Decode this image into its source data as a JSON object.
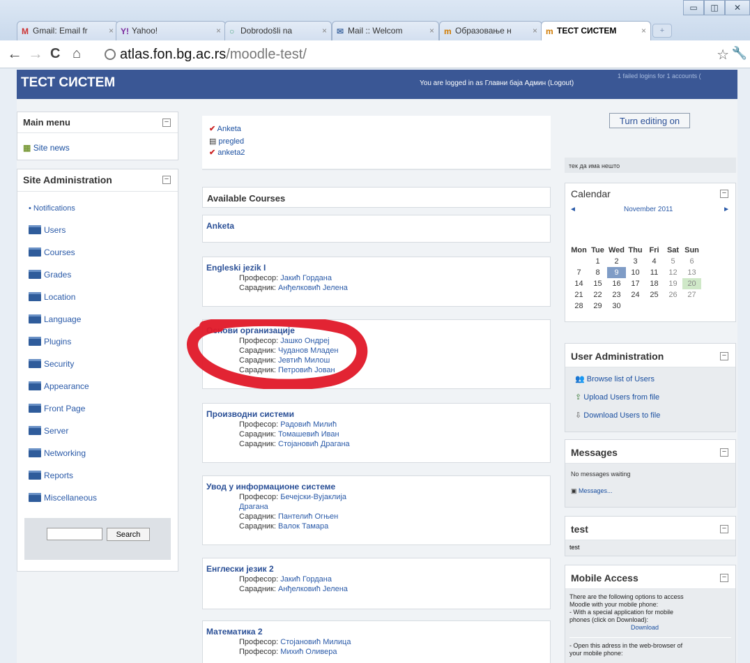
{
  "browser": {
    "tabs": [
      {
        "icon": "M",
        "label": "Gmail: Email fr"
      },
      {
        "icon": "Y!",
        "label": "Yahoo!"
      },
      {
        "icon": "○",
        "label": "Dobrodošli na"
      },
      {
        "icon": "✉",
        "label": "Mail :: Welcom"
      },
      {
        "icon": "m",
        "label": "Образовање н"
      },
      {
        "icon": "m",
        "label": "ТЕСТ СИСТЕМ"
      }
    ],
    "url_host": "atlas.fon.bg.ac.rs",
    "url_path": "/moodle-test/"
  },
  "header": {
    "site_title": "ТЕСТ СИСТЕМ",
    "login_text": "You are logged in as Главни баја Админ (Logout)",
    "failed_logins": "1 failed logins for 1 accounts ("
  },
  "main_menu": {
    "title": "Main menu",
    "items": [
      "Site news"
    ]
  },
  "site_admin": {
    "title": "Site Administration",
    "notifications": "Notifications",
    "items": [
      "Users",
      "Courses",
      "Grades",
      "Location",
      "Language",
      "Plugins",
      "Security",
      "Appearance",
      "Front Page",
      "Server",
      "Networking",
      "Reports",
      "Miscellaneous"
    ]
  },
  "search": {
    "button": "Search",
    "value": ""
  },
  "activities": [
    "Anketa",
    "pregled",
    "anketa2"
  ],
  "available_courses": {
    "title": "Available Courses",
    "courses": [
      {
        "name": "Anketa",
        "lines": []
      },
      {
        "name": "Engleski jezik I",
        "lines": [
          [
            "Професор:",
            "Јакић Гордана"
          ],
          [
            "Сарадник:",
            "Анђелковић Јелена"
          ]
        ]
      },
      {
        "name": "Основи организације",
        "lines": [
          [
            "Професор:",
            "Јашко Ондреј"
          ],
          [
            "Сарадник:",
            "Чуданов Младен"
          ],
          [
            "Сарадник:",
            "Јевтић Милош"
          ],
          [
            "Сарадник:",
            "Петровић Јован"
          ]
        ]
      },
      {
        "name": "Производни системи",
        "lines": [
          [
            "Професор:",
            "Радовић Милић"
          ],
          [
            "Сарадник:",
            "Томашевић Иван"
          ],
          [
            "Сарадник:",
            "Стојановић Драгана"
          ]
        ]
      },
      {
        "name": "Увод у информационе системе",
        "lines": [
          [
            "Професор:",
            "Бечејски-Вујаклија"
          ],
          [
            "",
            "Драгана"
          ],
          [
            "Сарадник:",
            "Пантелић Огњен"
          ],
          [
            "Сарадник:",
            "Валок Тамара"
          ]
        ]
      },
      {
        "name": "Енглески језик 2",
        "lines": [
          [
            "Професор:",
            "Јакић Гордана"
          ],
          [
            "Сарадник:",
            "Анђелковић Јелена"
          ]
        ]
      },
      {
        "name": "Математика 2",
        "lines": [
          [
            "Професор:",
            "Стојановић Милица"
          ],
          [
            "Професор:",
            "Михић Оливера"
          ]
        ]
      }
    ]
  },
  "right": {
    "turn_editing": "Turn editing on",
    "note": "тек да има нешто",
    "calendar": {
      "title": "Calendar",
      "month": "November 2011",
      "prev": "◄",
      "next": "►",
      "headers": [
        "Mon",
        "Tue",
        "Wed",
        "Thu",
        "Fri",
        "Sat",
        "Sun"
      ],
      "weeks": [
        [
          "",
          "1",
          "2",
          "3",
          "4",
          "5",
          "6"
        ],
        [
          "7",
          "8",
          "9",
          "10",
          "11",
          "12",
          "13"
        ],
        [
          "14",
          "15",
          "16",
          "17",
          "18",
          "19",
          "20"
        ],
        [
          "21",
          "22",
          "23",
          "24",
          "25",
          "26",
          "27"
        ],
        [
          "28",
          "29",
          "30",
          "",
          "",
          "",
          ""
        ]
      ],
      "today": "9",
      "marked": "20"
    },
    "user_admin": {
      "title": "User Administration",
      "items": [
        "Browse list of Users",
        "Upload Users from file",
        "Download Users to file"
      ]
    },
    "messages": {
      "title": "Messages",
      "status": "No messages waiting",
      "link": "Messages..."
    },
    "test": {
      "title": "test",
      "body": "test"
    },
    "mobile": {
      "title": "Mobile Access",
      "lines": [
        "There are the following options to access",
        "Moodle with your mobile phone:",
        "- With a special application for mobile",
        "phones (click on Download):"
      ],
      "download": "Download",
      "lines2": [
        "- Open this adress in the web-browser of",
        "your mobile phone:"
      ]
    }
  }
}
